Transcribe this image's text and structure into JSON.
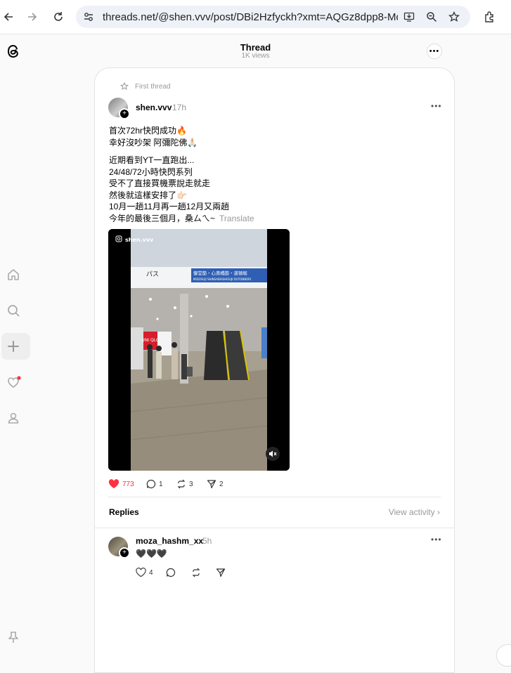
{
  "browser": {
    "url": "threads.net/@shen.vvv/post/DBi2Hzfyckh?xmt=AQGz8dpp8-MdK..."
  },
  "header": {
    "title": "Thread",
    "views": "1K views"
  },
  "post": {
    "first_thread_label": "First thread",
    "username": "shen.vvv",
    "time": "17h",
    "lines": [
      "首次72hr快閃成功🔥",
      "幸好沒吵架 阿彌陀佛🙏🏻",
      "近期看到YT一直跑出...",
      "24/48/72小時快閃系列",
      "受不了直接買機票說走就走",
      "然後就這樣安排了👉🏻",
      "10月一趟11月再一趟12月又兩趟",
      "今年的最後三個月，桑ㄙㄟ~"
    ],
    "translate_label": "Translate",
    "media": {
      "watermark": "shen.vvv",
      "sign_text": "パス",
      "sign_jp": "御堂筋・心斎橋筋・道頓堀",
      "sign_en": "MIDOSUJI SHINSAIBASHISUJI DOTONBORI",
      "store_sign": "UNI QLO"
    },
    "likes": "773",
    "comments": "1",
    "reposts": "3",
    "shares": "2"
  },
  "replies_section": {
    "label": "Replies",
    "view_activity": "View activity"
  },
  "reply": {
    "username": "moza_hashm_xx",
    "time": "5h",
    "text": "🖤🖤🖤",
    "likes": "4"
  }
}
